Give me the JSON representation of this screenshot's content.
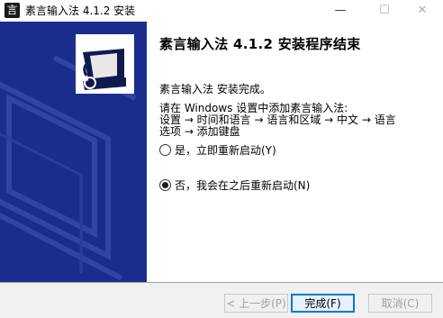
{
  "window": {
    "title": "素言输入法 4.1.2 安装",
    "app_icon_glyph": "言",
    "controls": {
      "minimize": "—",
      "maximize": "☐",
      "close": "✕"
    }
  },
  "sidebar": {
    "background": "#1a2d8c",
    "logo_icon": "installer-computer-icon"
  },
  "content": {
    "heading": "素言输入法 4.1.2 安装程序结束",
    "complete_message": "素言输入法 安装完成。",
    "instructions": [
      "请在 Windows 设置中添加素言输入法:",
      "设置 → 时间和语言 → 语言和区域 → 中文 → 语言",
      "选项 → 添加键盘"
    ],
    "options": [
      {
        "label": "是，立即重新启动(Y)",
        "selected": false
      },
      {
        "label": "否，我会在之后重新启动(N)",
        "selected": true
      }
    ]
  },
  "footer": {
    "back_label": "< 上一步(P)",
    "finish_label": "完成(F)",
    "cancel_label": "取消(C)"
  }
}
